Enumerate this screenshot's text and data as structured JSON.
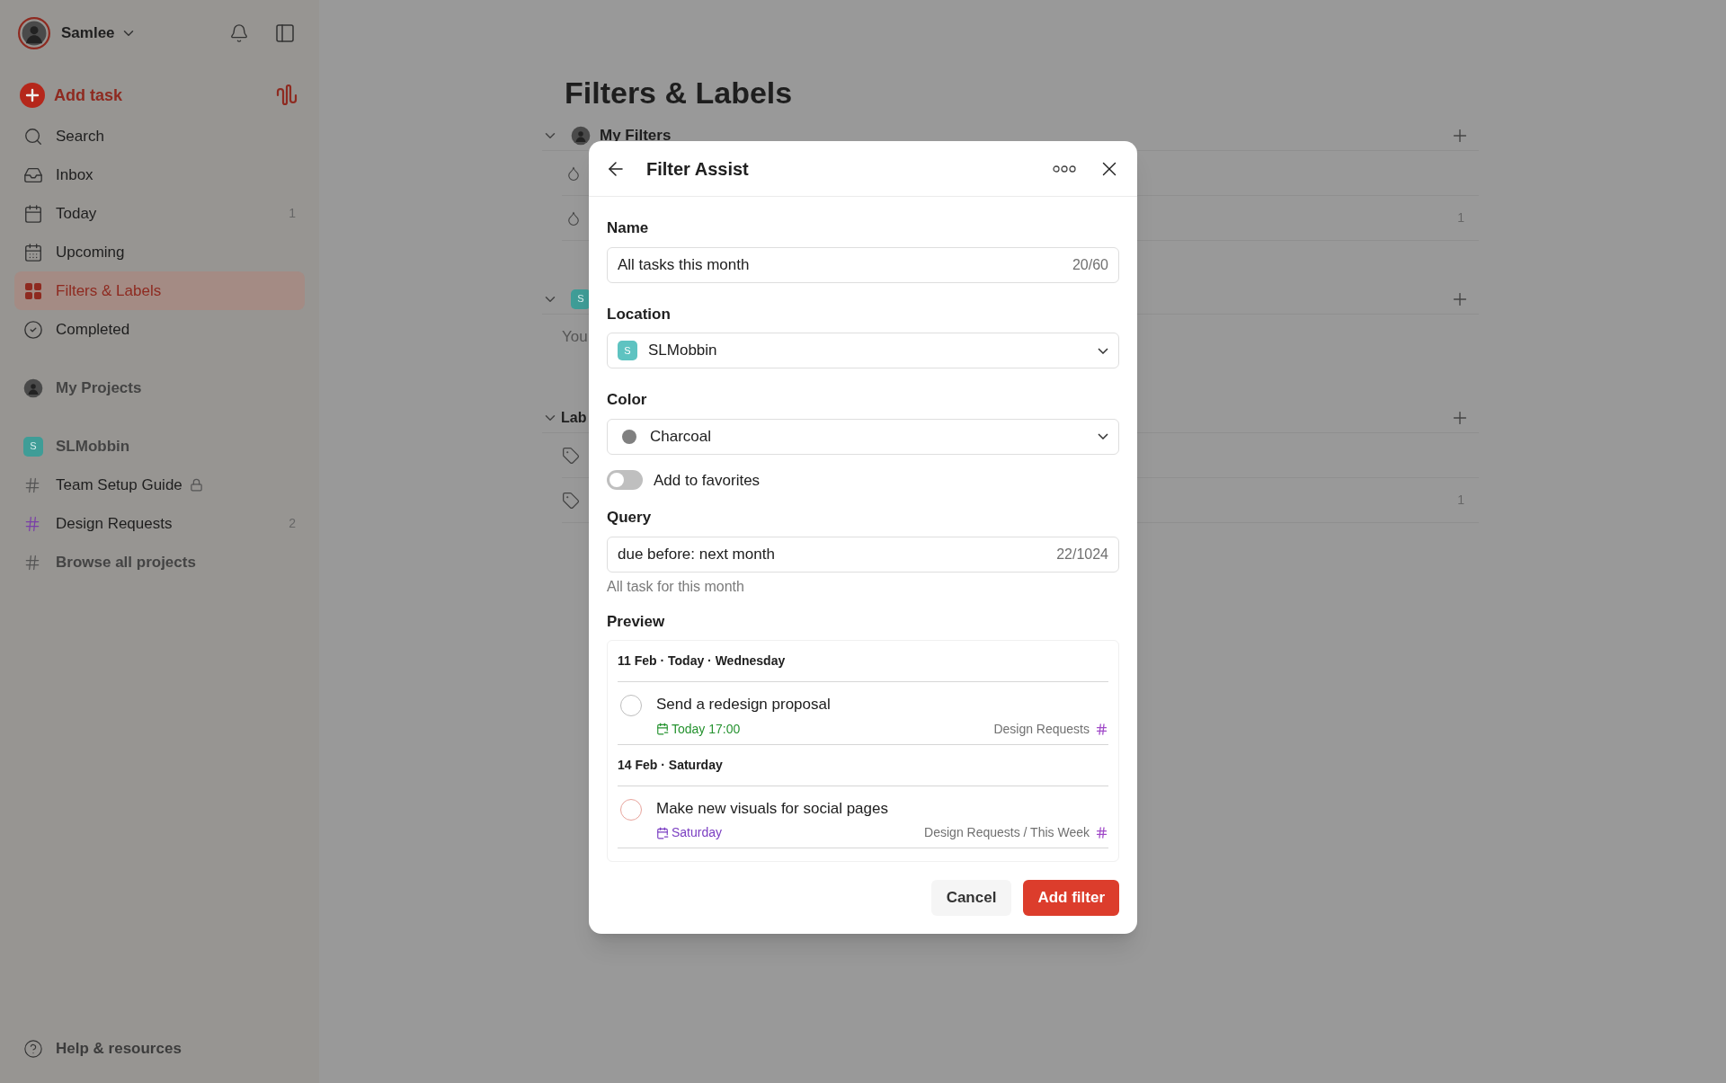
{
  "sidebar": {
    "user": {
      "name": "Samlee"
    },
    "add_task": "Add task",
    "nav": [
      {
        "label": "Search",
        "selected": false
      },
      {
        "label": "Inbox",
        "selected": false
      },
      {
        "label": "Today",
        "count": "1",
        "selected": false
      },
      {
        "label": "Upcoming",
        "selected": false
      },
      {
        "label": "Filters & Labels",
        "selected": true
      },
      {
        "label": "Completed",
        "selected": false
      }
    ],
    "my_projects": "My Projects",
    "workspace": {
      "letter": "S",
      "name": "SLMobbin"
    },
    "projects": [
      {
        "label": "Team Setup Guide",
        "color": "#555555",
        "locked": true
      },
      {
        "label": "Design Requests",
        "color": "#7a3fa8",
        "count": "2",
        "locked": false
      }
    ],
    "browse": "Browse all projects",
    "help": "Help & resources"
  },
  "main": {
    "title": "Filters & Labels",
    "sections": [
      {
        "kind": "filters",
        "title": "My Filters",
        "rows": [
          {},
          {
            "count": "1"
          }
        ]
      },
      {
        "kind": "workspace",
        "letter": "S",
        "rows": [
          {
            "text": "You"
          }
        ]
      },
      {
        "kind": "labels",
        "title": "Lab",
        "rows": [
          {},
          {
            "count": "1"
          }
        ]
      }
    ]
  },
  "modal": {
    "title": "Filter Assist",
    "name": {
      "label": "Name",
      "value": "All tasks this month",
      "counter": "20/60"
    },
    "location": {
      "label": "Location",
      "letter": "S",
      "value": "SLMobbin"
    },
    "color": {
      "label": "Color",
      "value": "Charcoal",
      "color": "#808080"
    },
    "favorites": {
      "label": "Add to favorites",
      "on": false
    },
    "query": {
      "label": "Query",
      "value": "due before: next month",
      "counter": "22/1024",
      "hint": "All task for this month"
    },
    "preview": {
      "label": "Preview",
      "groups": [
        {
          "heading": "11 Feb · Today · Wednesday",
          "tasks": [
            {
              "title": "Send a redesign proposal",
              "color": "#bdbdbd",
              "due": {
                "text": "Today 17:00",
                "color": "#25922f"
              },
              "project": "Design Requests"
            }
          ]
        },
        {
          "heading": "14 Feb · Saturday",
          "tasks": [
            {
              "title": "Make new visuals for social pages",
              "color": "#e8a49c",
              "due": {
                "text": "Saturday",
                "color": "#7b3fc2"
              },
              "project": "Design Requests / This Week"
            }
          ]
        }
      ]
    },
    "buttons": {
      "cancel": "Cancel",
      "add": "Add filter"
    }
  }
}
